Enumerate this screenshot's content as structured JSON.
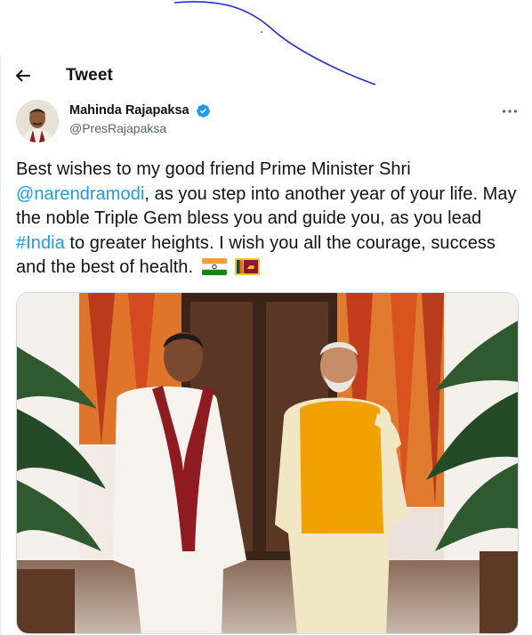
{
  "header": {
    "title": "Tweet"
  },
  "author": {
    "name": "Mahinda Rajapaksa",
    "handle": "@PresRajapaksa",
    "verified": true
  },
  "tweet": {
    "text_1": "Best wishes to my good friend Prime Minister Shri ",
    "mention": "@narendramodi",
    "text_2": ", as you step into another year of your life. May the noble Triple Gem bless you and guide you, as you lead ",
    "hashtag": "#India",
    "text_3": " to greater heights. I wish you all the courage, success and the best of health.",
    "flags": [
      "flag-india-icon",
      "flag-sri-lanka-icon"
    ]
  },
  "colors": {
    "link": "#1d9bf0",
    "verified": "#1d9bf0",
    "secondary_text": "#536471",
    "scribble": "#1f2fd6"
  },
  "icons": {
    "back": "arrow-left-icon",
    "more": "more-horizontal-icon",
    "verified": "verified-badge-icon"
  }
}
